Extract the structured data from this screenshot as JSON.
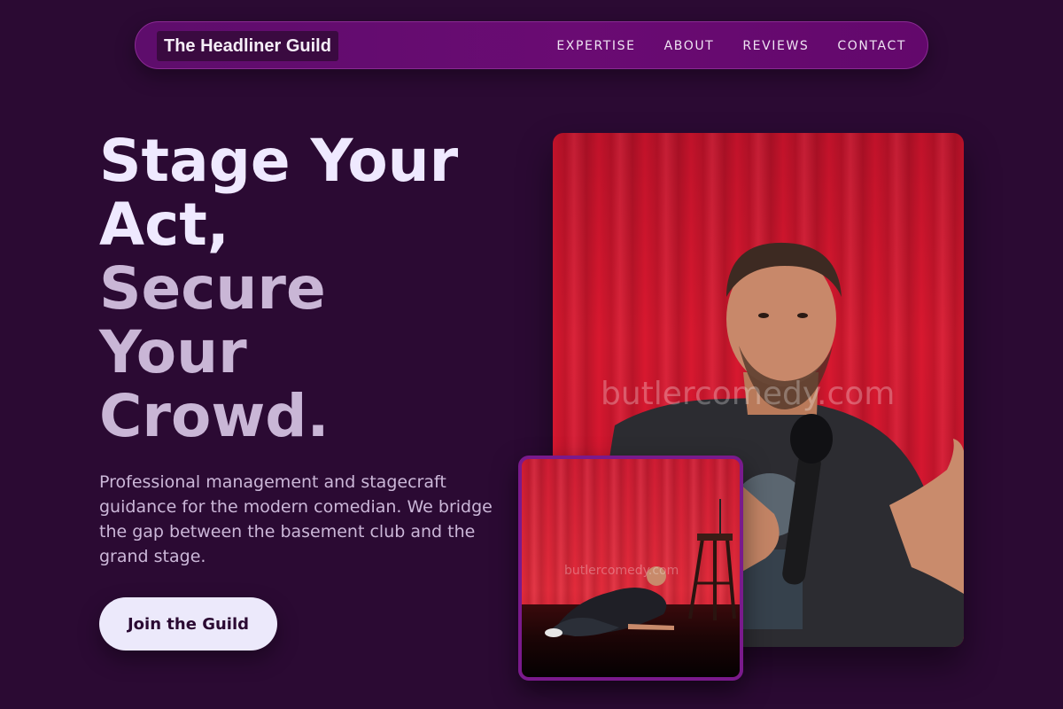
{
  "nav": {
    "brand": "The Headliner Guild",
    "links": [
      "EXPERTISE",
      "ABOUT",
      "REVIEWS",
      "CONTACT"
    ]
  },
  "hero": {
    "title_lines": [
      "Stage Your",
      "Act,",
      "Secure",
      "Your",
      "Crowd."
    ],
    "subtitle": "Professional management and stagecraft guidance for the modern comedian. We bridge the gap between the basement club and the grand stage.",
    "cta_label": "Join the Guild"
  },
  "photos": {
    "main_watermark": "butlercomedy.com",
    "inset_watermark": "butlercomedy.com",
    "main_alt": "Comedian holding a microphone in front of a red curtain",
    "inset_alt": "Comedian lying on stage with microphone in front of a red curtain"
  },
  "colors": {
    "background": "#2b0a33",
    "nav_background": "#6a0b73",
    "title_primary": "#efe9ff",
    "title_muted": "#c9b6d6",
    "cta_background": "#ece9fb",
    "curtain_red": "#d8182f",
    "inset_border": "#7a1a8c"
  }
}
